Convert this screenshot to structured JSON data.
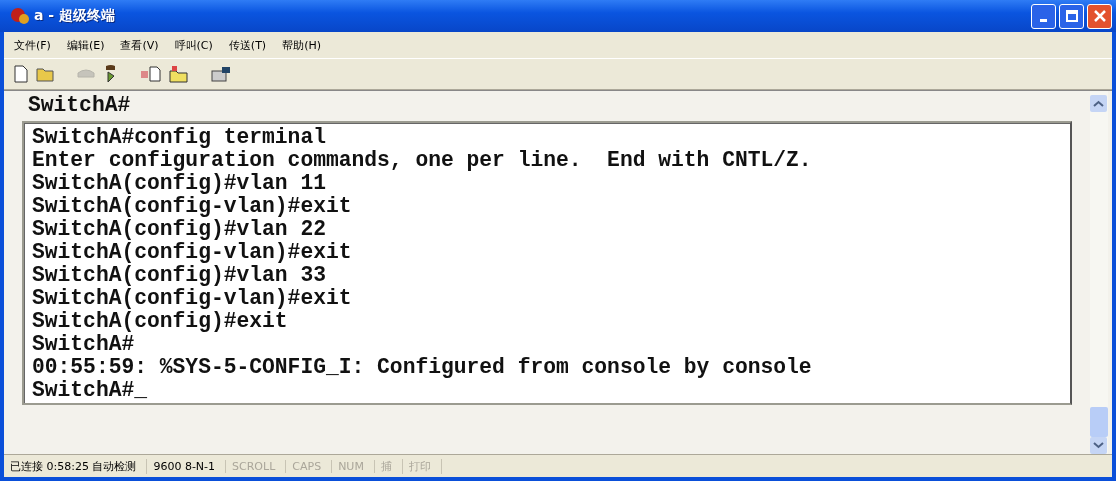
{
  "window": {
    "title": "a - 超级终端"
  },
  "menu": [
    "文件(F)",
    "编辑(E)",
    "查看(V)",
    "呼叫(C)",
    "传送(T)",
    "帮助(H)"
  ],
  "toolbar": [
    {
      "kind": "new",
      "disabled": false
    },
    {
      "kind": "open",
      "disabled": false
    },
    {
      "kind": "sep"
    },
    {
      "kind": "call",
      "disabled": true
    },
    {
      "kind": "disconnect",
      "disabled": false
    },
    {
      "kind": "sep"
    },
    {
      "kind": "send",
      "disabled": false
    },
    {
      "kind": "receive",
      "disabled": false
    },
    {
      "kind": "sep"
    },
    {
      "kind": "properties",
      "disabled": false
    }
  ],
  "terminal": {
    "header_line": "SwitchA#",
    "lines": [
      "SwitchA#config terminal",
      "Enter configuration commands, one per line.  End with CNTL/Z.",
      "SwitchA(config)#vlan 11",
      "SwitchA(config-vlan)#exit",
      "SwitchA(config)#vlan 22",
      "SwitchA(config-vlan)#exit",
      "SwitchA(config)#vlan 33",
      "SwitchA(config-vlan)#exit",
      "SwitchA(config)#exit",
      "SwitchA#",
      "00:55:59: %SYS-5-CONFIG_I: Configured from console by console",
      "SwitchA#_"
    ]
  },
  "status_bar": [
    {
      "text": "已连接 0:58:25 自动检测",
      "disabled": false
    },
    {
      "text": "9600 8-N-1",
      "disabled": false
    },
    {
      "text": "SCROLL",
      "disabled": true
    },
    {
      "text": "CAPS",
      "disabled": true
    },
    {
      "text": "NUM",
      "disabled": true
    },
    {
      "text": "捕",
      "disabled": true
    },
    {
      "text": "打印",
      "disabled": true
    }
  ]
}
